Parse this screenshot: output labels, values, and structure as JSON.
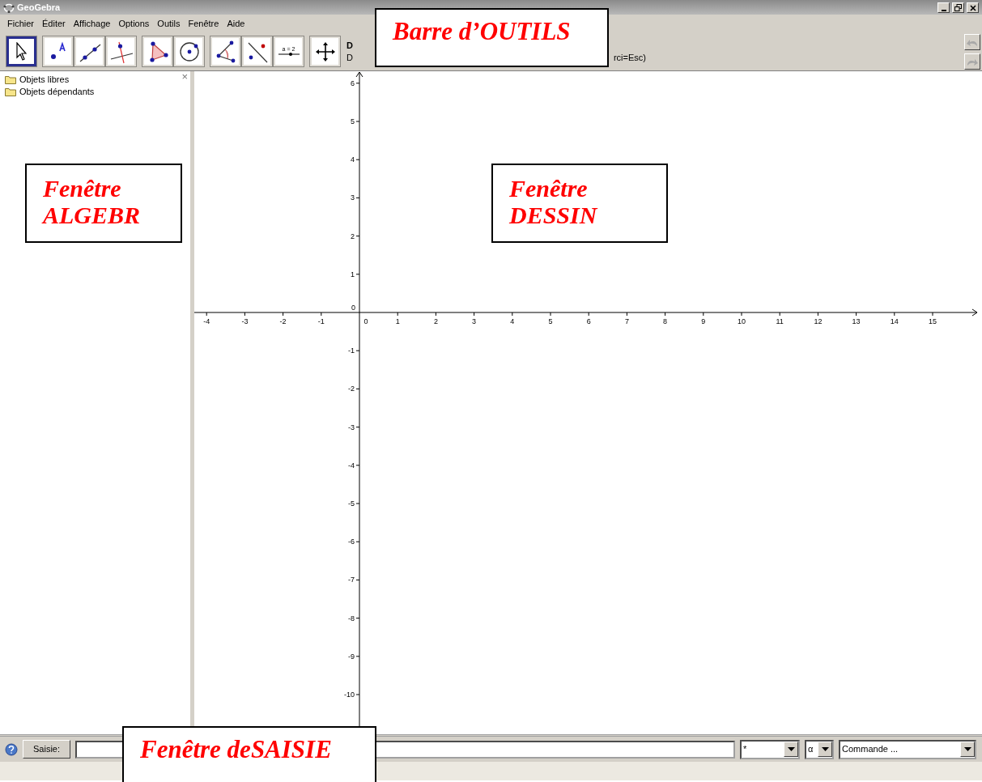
{
  "window": {
    "title": "GeoGebra"
  },
  "menu": [
    "Fichier",
    "Éditer",
    "Affichage",
    "Options",
    "Outils",
    "Fenêtre",
    "Aide"
  ],
  "toolbar": {
    "groups": [
      [
        {
          "kind": "move",
          "selected": true
        }
      ],
      [
        {
          "kind": "point",
          "selected": false
        },
        {
          "kind": "line",
          "selected": false
        },
        {
          "kind": "perpendicular",
          "selected": false
        }
      ],
      [
        {
          "kind": "polygon",
          "selected": false
        },
        {
          "kind": "circle",
          "selected": false
        }
      ],
      [
        {
          "kind": "angle",
          "selected": false
        },
        {
          "kind": "reflect",
          "selected": false
        },
        {
          "kind": "slider",
          "selected": false,
          "label": "a = 2"
        }
      ],
      [
        {
          "kind": "pan",
          "selected": false
        }
      ]
    ],
    "tool_title": "D",
    "tool_help_start": "D",
    "tool_help_end": "rci=Esc)",
    "undo": {
      "disabled": true
    },
    "redo": {
      "disabled": true
    }
  },
  "algebra": {
    "close": "×",
    "folders": [
      "Objets libres",
      "Objets dépendants"
    ]
  },
  "graphics": {
    "x_ticks": [
      "-4",
      "-3",
      "-2",
      "-1",
      "0",
      "1",
      "2",
      "3",
      "4",
      "5",
      "6",
      "7",
      "8",
      "9",
      "10",
      "11",
      "12",
      "13",
      "14",
      "15"
    ],
    "y_origin": "0",
    "y_ticks": [
      "6",
      "5",
      "4",
      "3",
      "2",
      "1",
      "-1",
      "-2",
      "-3",
      "-4",
      "-5",
      "-6",
      "-7",
      "-8",
      "-9",
      "-10"
    ]
  },
  "input_bar": {
    "button": "Saisie:",
    "symbols": "*",
    "greek": "α",
    "command": "Commande ..."
  },
  "annotations": [
    "Barre d’OUTILS",
    "Fenêtre ALGEBR",
    "Fenêtre DESSIN",
    "Fenêtre deSAISIE"
  ]
}
